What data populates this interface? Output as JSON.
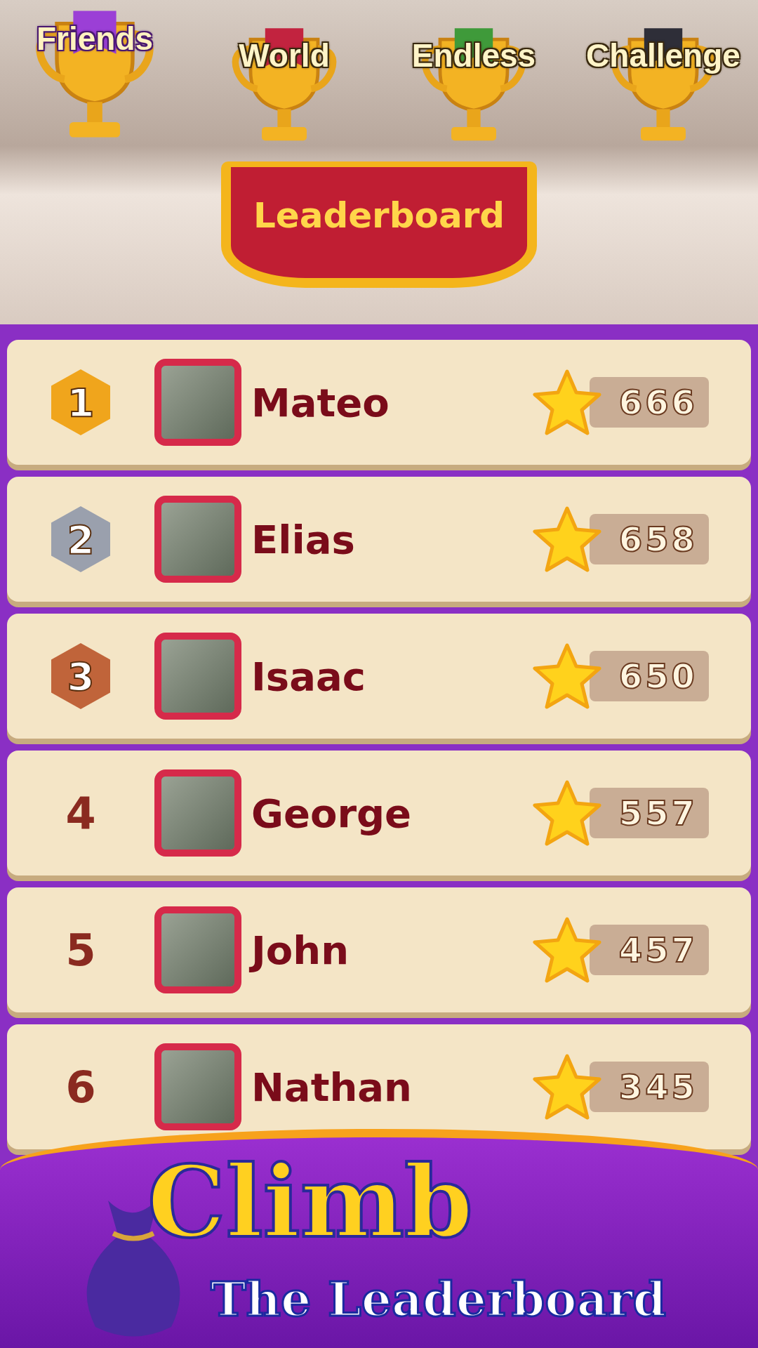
{
  "tabs": [
    {
      "label": "Friends",
      "selected": true,
      "color": "#9b3fd6"
    },
    {
      "label": "World",
      "selected": false,
      "color": "#c2233f"
    },
    {
      "label": "Endless",
      "selected": false,
      "color": "#3f9a3a"
    },
    {
      "label": "Challenge",
      "selected": false,
      "color": "#2e2e38"
    }
  ],
  "title": "Leaderboard",
  "rows": [
    {
      "rank": "1",
      "kind": "medal",
      "color": "#f0a51c",
      "name": "Mateo",
      "score": "666"
    },
    {
      "rank": "2",
      "kind": "medal",
      "color": "#9aa0ad",
      "name": "Elias",
      "score": "658"
    },
    {
      "rank": "3",
      "kind": "medal",
      "color": "#c0643a",
      "name": "Isaac",
      "score": "650"
    },
    {
      "rank": "4",
      "kind": "plain",
      "name": "George",
      "score": "557"
    },
    {
      "rank": "5",
      "kind": "plain",
      "name": "John",
      "score": "457"
    },
    {
      "rank": "6",
      "kind": "plain",
      "name": "Nathan",
      "score": "345"
    }
  ],
  "banner": {
    "headline": "Climb",
    "subline": "The Leaderboard"
  }
}
